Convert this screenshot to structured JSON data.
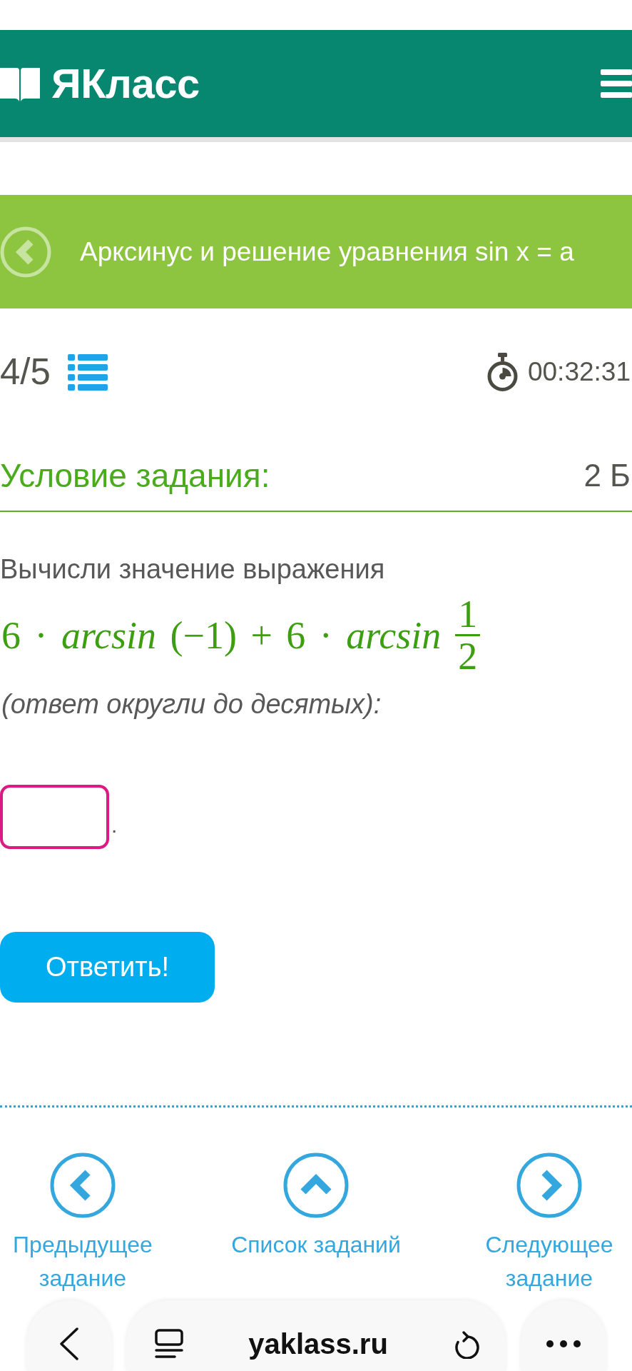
{
  "header": {
    "logo": "ЯКласс"
  },
  "topic": {
    "title": "Арксинус и решение уравнения sin x = a"
  },
  "progress": {
    "counter": "4/5",
    "timer": "00:32:31"
  },
  "task": {
    "heading": "Условие задания:",
    "points": "2 Б",
    "prompt": "Вычисли значение выражения",
    "formula": {
      "expression": "6 · *arcsin* (−1) + 6 · *arcsin*",
      "fraction": {
        "numerator": "1",
        "denominator": "2"
      }
    },
    "note": "(ответ округли до десятых):",
    "answer": {
      "suffix": "."
    },
    "submit": "Ответить!"
  },
  "task_nav": [
    {
      "kind": "previous",
      "label": "Предыдущее задание"
    },
    {
      "kind": "list",
      "label": "Список заданий"
    },
    {
      "kind": "next",
      "label": "Следующее задание"
    }
  ],
  "browser_bar": {
    "url": "yaklass.ru"
  }
}
